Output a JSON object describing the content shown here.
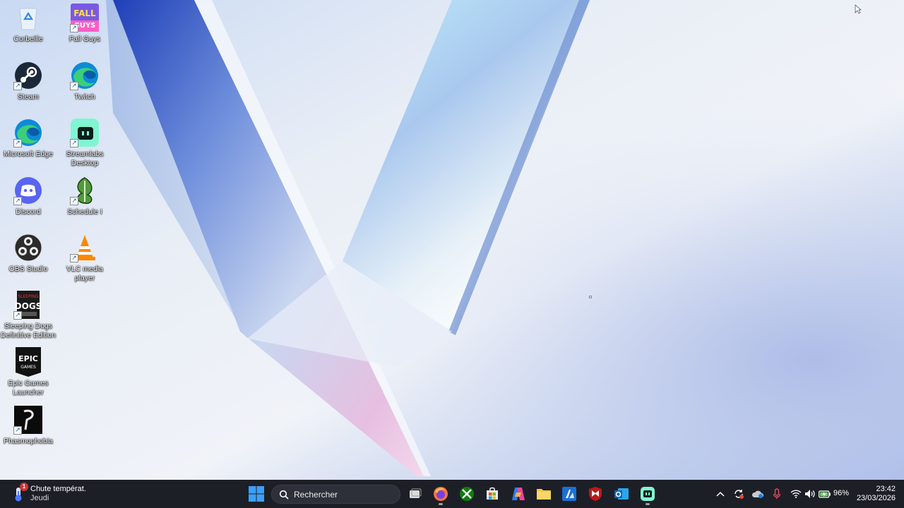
{
  "desktop": {
    "icons": [
      {
        "label": "Corbeille",
        "icon": "recycle-bin-icon"
      },
      {
        "label": "Fall Guys",
        "icon": "fall-guys-icon"
      },
      {
        "label": "Steam",
        "icon": "steam-icon"
      },
      {
        "label": "Twitch",
        "icon": "edge-icon"
      },
      {
        "label": "Microsoft Edge",
        "icon": "edge-icon"
      },
      {
        "label": "Streamlabs Desktop",
        "icon": "streamlabs-icon"
      },
      {
        "label": "Discord",
        "icon": "discord-icon"
      },
      {
        "label": "Schedule I",
        "icon": "schedule-i-icon"
      },
      {
        "label": "OBS Studio",
        "icon": "obs-icon"
      },
      {
        "label": "VLC media player",
        "icon": "vlc-icon"
      },
      {
        "label": "Sleeping Dogs Definitive Edition",
        "icon": "sleeping-dogs-icon"
      },
      {
        "label": "Epic Games Launcher",
        "icon": "epic-games-icon"
      },
      {
        "label": "Phasmophobia",
        "icon": "phasmophobia-icon"
      }
    ]
  },
  "taskbar": {
    "weather": {
      "title": "Chute températ.",
      "subtitle": "Jeudi",
      "badge": "1"
    },
    "search_placeholder": "Rechercher",
    "battery_percent": "96%",
    "clock_time": "23:42",
    "clock_date": "23/03/2026",
    "pinned_apps": [
      "task-view",
      "firefox",
      "xbox",
      "microsoft-store",
      "copilot",
      "file-explorer",
      "azure",
      "mcafee",
      "outlook",
      "streamlabs"
    ]
  },
  "colors": {
    "taskbar_bg": "#1d1f27",
    "accent": "#0078d4"
  }
}
